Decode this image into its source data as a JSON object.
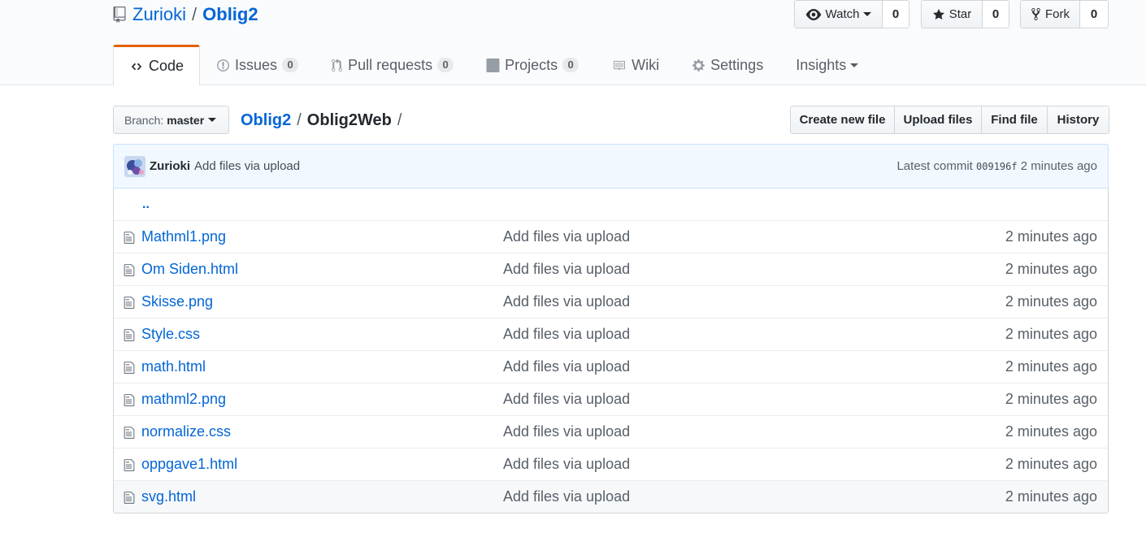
{
  "repo": {
    "owner": "Zurioki",
    "separator": "/",
    "name": "Oblig2"
  },
  "actions": {
    "watch": {
      "label": "Watch",
      "count": "0"
    },
    "star": {
      "label": "Star",
      "count": "0"
    },
    "fork": {
      "label": "Fork",
      "count": "0"
    }
  },
  "nav": {
    "code": "Code",
    "issues": {
      "label": "Issues",
      "count": "0"
    },
    "pulls": {
      "label": "Pull requests",
      "count": "0"
    },
    "projects": {
      "label": "Projects",
      "count": "0"
    },
    "wiki": "Wiki",
    "settings": "Settings",
    "insights": "Insights"
  },
  "branch": {
    "label": "Branch:",
    "name": "master"
  },
  "breadcrumb": {
    "root": "Oblig2",
    "sep1": "/",
    "current": "Oblig2Web",
    "sep2": "/"
  },
  "file_nav": {
    "create": "Create new file",
    "upload": "Upload files",
    "find": "Find file",
    "history": "History"
  },
  "commit": {
    "author": "Zurioki",
    "message": "Add files via upload",
    "latest_label": "Latest commit",
    "sha": "009196f",
    "age": "2 minutes ago"
  },
  "parent_dir": "..",
  "files": [
    {
      "name": "Mathml1.png",
      "message": "Add files via upload",
      "age": "2 minutes ago"
    },
    {
      "name": "Om Siden.html",
      "message": "Add files via upload",
      "age": "2 minutes ago"
    },
    {
      "name": "Skisse.png",
      "message": "Add files via upload",
      "age": "2 minutes ago"
    },
    {
      "name": "Style.css",
      "message": "Add files via upload",
      "age": "2 minutes ago"
    },
    {
      "name": "math.html",
      "message": "Add files via upload",
      "age": "2 minutes ago"
    },
    {
      "name": "mathml2.png",
      "message": "Add files via upload",
      "age": "2 minutes ago"
    },
    {
      "name": "normalize.css",
      "message": "Add files via upload",
      "age": "2 minutes ago"
    },
    {
      "name": "oppgave1.html",
      "message": "Add files via upload",
      "age": "2 minutes ago"
    },
    {
      "name": "svg.html",
      "message": "Add files via upload",
      "age": "2 minutes ago"
    }
  ],
  "colors": {
    "link": "#0366d6",
    "tab_accent": "#e36209",
    "commit_bg": "#f1f8ff"
  }
}
